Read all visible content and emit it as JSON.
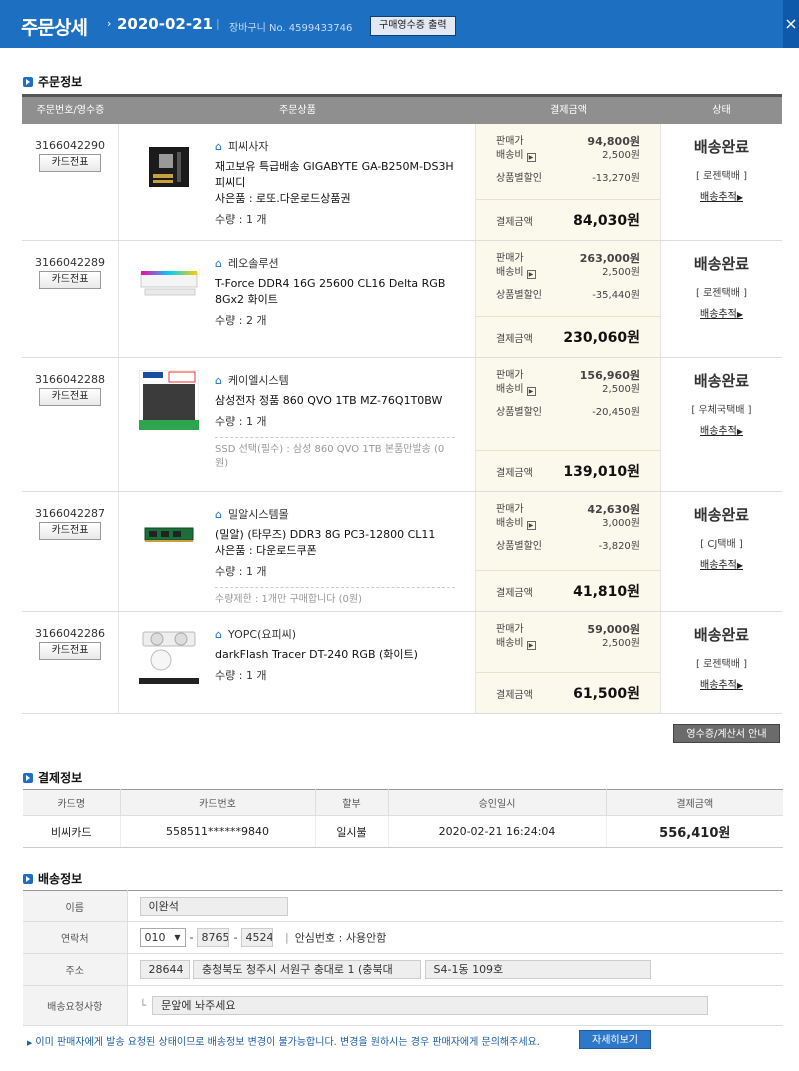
{
  "header": {
    "title": "주문상세",
    "date": "2020-02-21",
    "separator": "|",
    "cart_no": "장바구니 No. 4599433746",
    "receipt_print_button": "구매영수증 출력",
    "close_label": "×"
  },
  "order_section": {
    "title": "주문정보",
    "columns": [
      "주문번호/영수증",
      "주문상품",
      "결제금액",
      "상태"
    ],
    "card_slip_label": "카드전표",
    "price_label": "판매가",
    "shipping_label": "배송비",
    "discount_label": "상품별할인",
    "total_label": "결제금액",
    "track_label": "배송추적",
    "orders": [
      {
        "order_no": "3166042290",
        "seller": "피씨사자",
        "name": "재고보유 특급배송 GIGABYTE GA-B250M-DS3H 피씨디",
        "gift": "사은품 : 로또.다운로드상품권",
        "qty": "수량 : 1 개",
        "option": "",
        "price": "94,800원",
        "shipping": "2,500원",
        "discount": "-13,270원",
        "total": "84,030원",
        "status": "배송완료",
        "carrier": "[ 로젠택배 ]"
      },
      {
        "order_no": "3166042289",
        "seller": "레오솔루션",
        "name": "T-Force DDR4 16G 25600 CL16 Delta RGB 8Gx2 화이트",
        "gift": "",
        "qty": "수량 : 2 개",
        "option": "",
        "price": "263,000원",
        "shipping": "2,500원",
        "discount": "-35,440원",
        "total": "230,060원",
        "status": "배송완료",
        "carrier": "[ 로젠택배 ]"
      },
      {
        "order_no": "3166042288",
        "seller": "케이엘시스템",
        "name": "삼성전자 정품 860 QVO 1TB MZ-76Q1T0BW",
        "gift": "",
        "qty": "수량 : 1 개",
        "option": "SSD 선택(필수) : 삼성 860 QVO 1TB 본품만발송 (0원)",
        "price": "156,960원",
        "shipping": "2,500원",
        "discount": "-20,450원",
        "total": "139,010원",
        "status": "배송완료",
        "carrier": "[ 우체국택배 ]"
      },
      {
        "order_no": "3166042287",
        "seller": "밀알시스템몰",
        "name": "(밀알) (타무즈) DDR3 8G PC3-12800 CL11",
        "gift": "사은품 : 다운로드쿠폰",
        "qty": "수량 : 1 개",
        "option": "수량제한 : 1개만 구매합니다 (0원)",
        "price": "42,630원",
        "shipping": "3,000원",
        "discount": "-3,820원",
        "total": "41,810원",
        "status": "배송완료",
        "carrier": "[ CJ택배 ]"
      },
      {
        "order_no": "3166042286",
        "seller": "YOPC(요피씨)",
        "name": "darkFlash Tracer DT-240 RGB (화이트)",
        "gift": "",
        "qty": "수량 : 1 개",
        "option": "",
        "price": "59,000원",
        "shipping": "2,500원",
        "discount": "",
        "total": "61,500원",
        "status": "배송완료",
        "carrier": "[ 로젠택배 ]"
      }
    ],
    "receipt_guide_button": "영수증/계산서 안내"
  },
  "payment_section": {
    "title": "결제정보",
    "columns": [
      "카드명",
      "카드번호",
      "할부",
      "승인일시",
      "결제금액"
    ],
    "row": {
      "card": "비씨카드",
      "number": "558511******9840",
      "installment": "일시불",
      "approved": "2020-02-21 16:24:04",
      "amount": "556,410원"
    }
  },
  "delivery_section": {
    "title": "배송정보",
    "labels": {
      "name": "이름",
      "phone": "연락처",
      "address": "주소",
      "request": "배송요청사항"
    },
    "name": "이완석",
    "phone1": "010",
    "phone2": "8765",
    "phone3": "4524",
    "safe_number": "안심번호 : 사용안함",
    "zip": "28644",
    "address1": "충청북도 청주시 서원구 충대로 1 (충북대",
    "address2": "S4-1동 109호",
    "request": "문앞에 놔주세요"
  },
  "notice": {
    "text": "이미 판매자에게 발송 요청된 상태이므로 배송정보 변경이 불가능합니다. 변경을 원하시는 경우 판매자에게 문의해주세요.",
    "more_button": "자세히보기"
  },
  "colors": {
    "header_bg": "#1d6fc2",
    "pay_bg": "#fbf8ec",
    "accent": "#1d6fc2"
  }
}
